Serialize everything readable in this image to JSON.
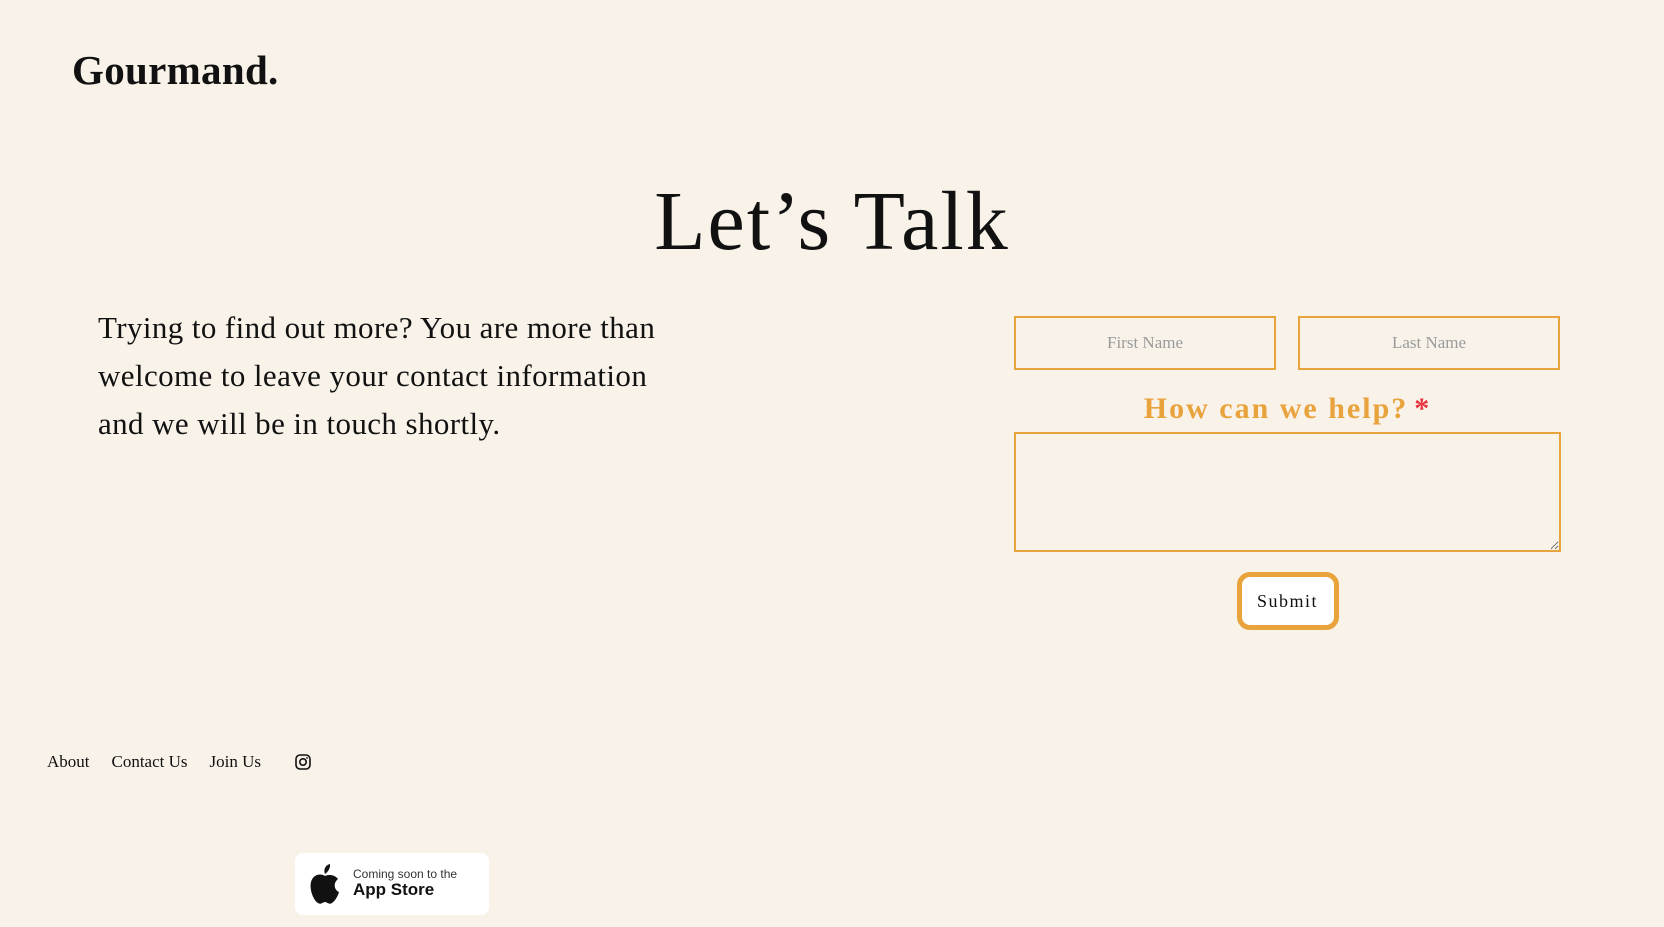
{
  "header": {
    "logo": "Gourmand."
  },
  "main": {
    "title": "Let’s Talk",
    "intro": "Trying to find out more? You are more than welcome to leave your contact information and we will be in touch shortly."
  },
  "form": {
    "first_name_placeholder": "First Name",
    "last_name_placeholder": "Last Name",
    "first_name_value": "",
    "last_name_value": "",
    "help_label": "How can we help?",
    "required_marker": "*",
    "message_value": "",
    "submit_label": "Submit"
  },
  "footer": {
    "links": [
      "About",
      "Contact Us",
      "Join Us"
    ],
    "social_icon": "instagram-icon",
    "app_badge": {
      "small_text": "Coming soon to the",
      "big_text": "App Store",
      "icon": "apple-icon"
    }
  },
  "colors": {
    "background": "#f8f2e9",
    "accent": "#e8a33c",
    "required": "#e8353f",
    "text": "#111111"
  }
}
